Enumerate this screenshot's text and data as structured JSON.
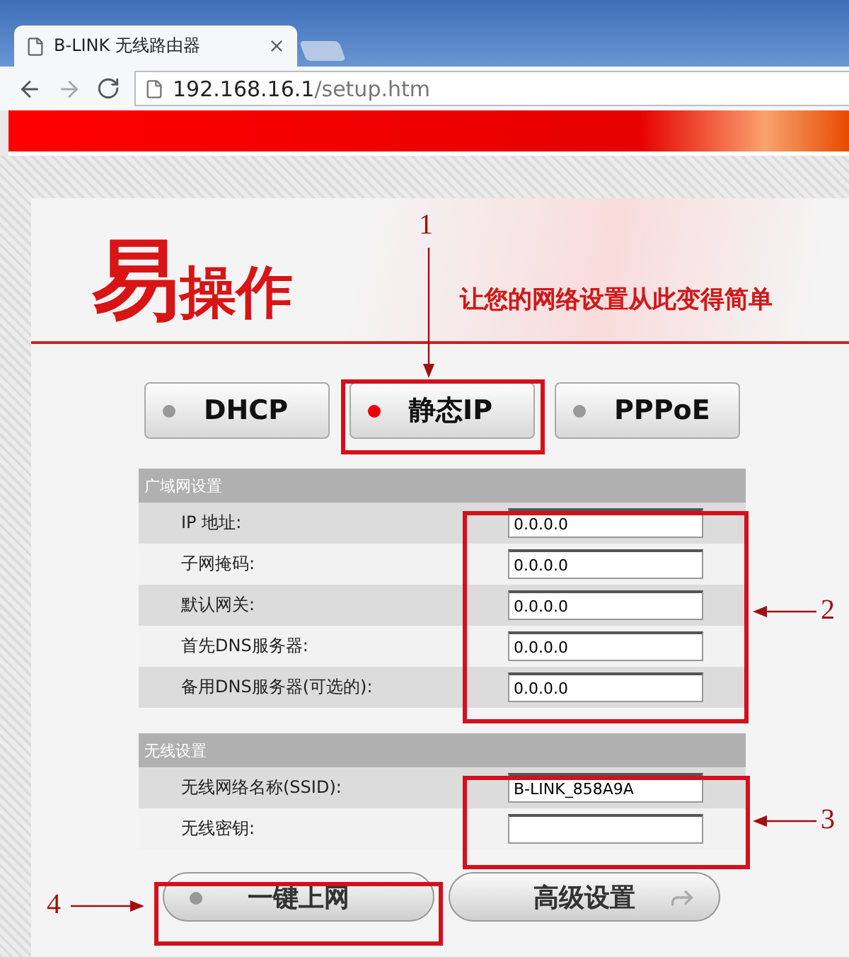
{
  "browser": {
    "tab_title": "B-LINK 无线路由器",
    "url_host": "192.168.16.1",
    "url_path": "/setup.htm"
  },
  "header": {
    "logo_mark": "易",
    "logo_text": "操作",
    "slogan": "让您的网络设置从此变得简单"
  },
  "modes": [
    {
      "label": "DHCP",
      "selected": false
    },
    {
      "label": "静态IP",
      "selected": true
    },
    {
      "label": "PPPoE",
      "selected": false
    }
  ],
  "sections": [
    {
      "title": "广域网设置",
      "rows": [
        {
          "label": "IP 地址:",
          "value": "0.0.0.0"
        },
        {
          "label": "子网掩码:",
          "value": "0.0.0.0"
        },
        {
          "label": "默认网关:",
          "value": "0.0.0.0"
        },
        {
          "label": "首先DNS服务器:",
          "value": "0.0.0.0"
        },
        {
          "label": "备用DNS服务器(可选的):",
          "value": "0.0.0.0"
        }
      ]
    },
    {
      "title": "无线设置",
      "rows": [
        {
          "label": "无线网络名称(SSID):",
          "value": "B-LINK_858A9A"
        },
        {
          "label": "无线密钥:"
        }
      ]
    }
  ],
  "actions": [
    {
      "label": "一键上网",
      "kind": "dot"
    },
    {
      "label": "高级设置",
      "kind": "arrow"
    }
  ],
  "annotations": [
    {
      "number": "1"
    },
    {
      "number": "2"
    },
    {
      "number": "3"
    },
    {
      "number": "4"
    }
  ]
}
